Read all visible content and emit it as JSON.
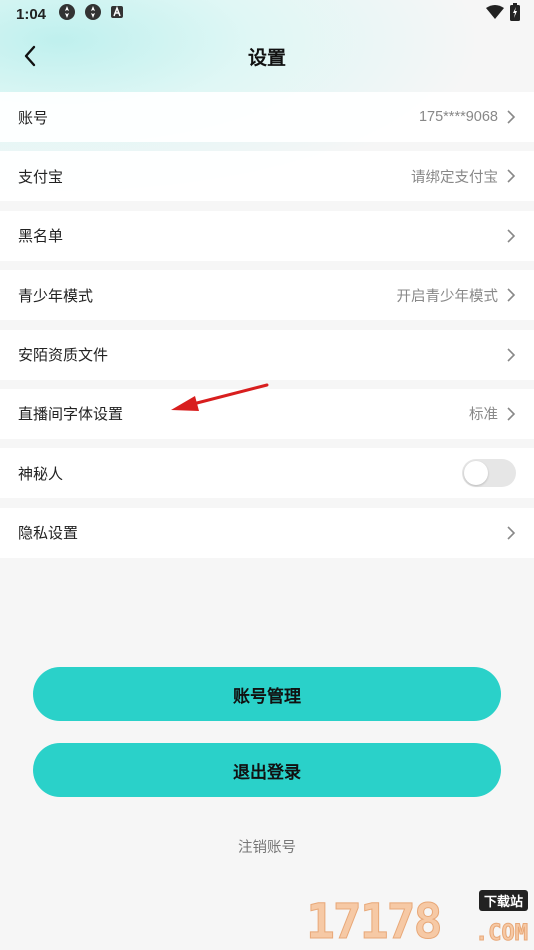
{
  "status_bar": {
    "time": "1:04",
    "icons": [
      "sync-icon",
      "sync-icon",
      "notification-a-icon",
      "wifi-icon",
      "battery-charging-icon"
    ]
  },
  "header": {
    "title": "设置",
    "back_icon": "chevron-left-icon"
  },
  "settings": {
    "account": {
      "label": "账号",
      "value": "175****9068"
    },
    "alipay": {
      "label": "支付宝",
      "value": "请绑定支付宝"
    },
    "blacklist": {
      "label": "黑名单",
      "value": ""
    },
    "teen_mode": {
      "label": "青少年模式",
      "value": "开启青少年模式"
    },
    "qualification": {
      "label": "安陌资质文件",
      "value": ""
    },
    "live_font": {
      "label": "直播间字体设置",
      "value": "标准"
    },
    "mystery": {
      "label": "神秘人",
      "toggle_on": false
    },
    "privacy": {
      "label": "隐私设置",
      "value": ""
    }
  },
  "buttons": {
    "account_manage": "账号管理",
    "logout": "退出登录",
    "cancel_account": "注销账号"
  },
  "watermark": {
    "number": "17178",
    "tag": "下载站",
    "domain": ".COM"
  },
  "colors": {
    "accent": "#2ad1c9",
    "annotation_arrow": "#d81e1e",
    "background": "#f6f6f6"
  }
}
